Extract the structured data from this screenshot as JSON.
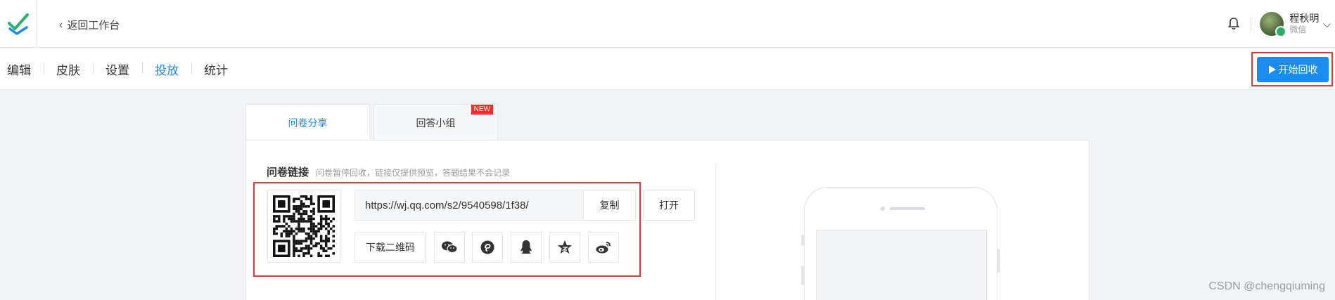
{
  "header": {
    "back_label": "返回工作台",
    "user_name": "程秋明",
    "user_source": "微信"
  },
  "nav": {
    "tabs": [
      "编辑",
      "皮肤",
      "设置",
      "投放",
      "统计"
    ],
    "active_tab": "投放",
    "start_button": "开始回收"
  },
  "panel_tabs": {
    "share": "问卷分享",
    "group": "回答小组",
    "badge": "NEW"
  },
  "link_section": {
    "title": "问卷链接",
    "hint": "问卷暂停回收，链接仅提供预览，答题结果不会记录",
    "url": "https://wj.qq.com/s2/9540598/1f38/",
    "copy_label": "复制",
    "open_label": "打开",
    "download_qr_label": "下载二维码",
    "share_icons": [
      "wechat-icon",
      "moments-icon",
      "qq-icon",
      "qzone-icon",
      "weibo-icon"
    ]
  },
  "watermark": "CSDN @chengqiuming",
  "colors": {
    "accent": "#1a8cf0",
    "highlight": "#e03a3a",
    "badge": "#e8312e"
  }
}
